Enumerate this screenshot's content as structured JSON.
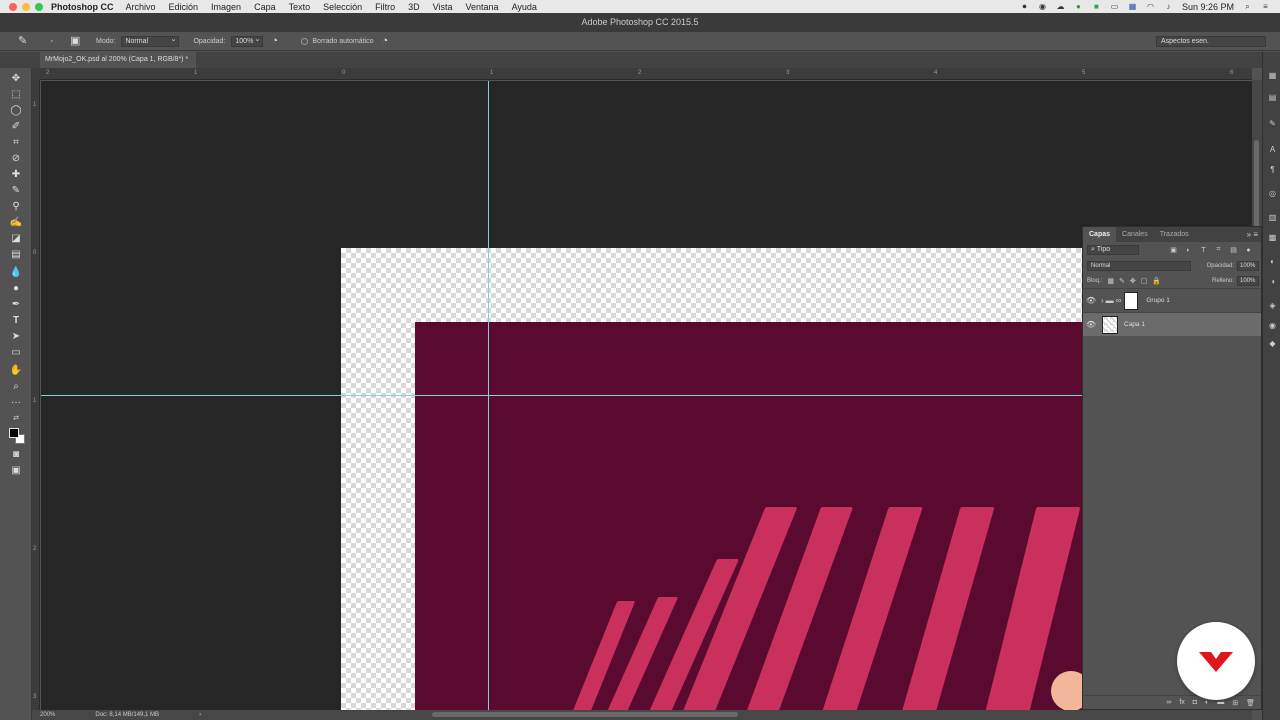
{
  "menubar": {
    "app_name": "Photoshop CC",
    "items": [
      "Archivo",
      "Edición",
      "Imagen",
      "Capa",
      "Texto",
      "Selección",
      "Filtro",
      "3D",
      "Vista",
      "Ventana",
      "Ayuda"
    ],
    "clock": "Sun 9:26 PM"
  },
  "window": {
    "title": "Adobe Photoshop CC 2015.5"
  },
  "options_bar": {
    "mode_label": "Modo:",
    "mode_value": "Normal",
    "opacity_label": "Opacidad:",
    "opacity_value": "100%",
    "auto_erase_label": "Borrado automático",
    "workspace": "Aspectos esen."
  },
  "document": {
    "tab_title": "MrMojo2_OK.psd al 200% (Capa 1, RGB/8*) *",
    "zoom": "200%",
    "doc_info": "Doc: 8,14 MB/149,1 MB"
  },
  "rulers": {
    "top": [
      "2",
      "1",
      "0",
      "1",
      "2",
      "3",
      "4",
      "5",
      "6"
    ],
    "left": [
      "1",
      "0",
      "1",
      "2",
      "3"
    ]
  },
  "layers_panel": {
    "tabs": [
      "Capas",
      "Canales",
      "Trazados"
    ],
    "filter_value": "Tipo",
    "blend_mode": "Normal",
    "opacity_label": "Opacidad:",
    "opacity_value": "100%",
    "lock_label": "Bloq.:",
    "fill_label": "Relleno:",
    "fill_value": "100%",
    "layers": [
      {
        "name": "Grupo 1",
        "type": "group",
        "selected": false
      },
      {
        "name": "Capa 1",
        "type": "layer",
        "selected": true
      }
    ]
  },
  "colors": {
    "canvas_bg": "#262626",
    "crimson": "#5a0a2f",
    "stripes": "#c9305e",
    "guides": "#7bd4d8",
    "logo": "#e0161e"
  }
}
